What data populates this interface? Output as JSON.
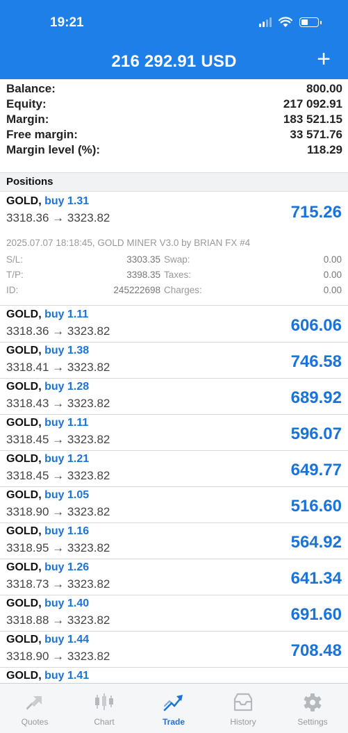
{
  "status_bar": {
    "time": "19:21"
  },
  "header": {
    "title": "216 292.91 USD",
    "add_label": "+"
  },
  "summary": [
    {
      "label": "Balance:",
      "value": "800.00"
    },
    {
      "label": "Equity:",
      "value": "217 092.91"
    },
    {
      "label": "Margin:",
      "value": "183 521.15"
    },
    {
      "label": "Free margin:",
      "value": "33 571.76"
    },
    {
      "label": "Margin level (%):",
      "value": "118.29"
    }
  ],
  "positions_label": "Positions",
  "expanded_position": {
    "symbol": "GOLD,",
    "type": "buy 1.31",
    "prices": "3318.36 → 3323.82",
    "profit": "715.26",
    "comment": "2025.07.07 18:18:45, GOLD MINER V3.0 by BRIAN FX #4",
    "details": {
      "sl_label": "S/L:",
      "sl_value": "3303.35",
      "tp_label": "T/P:",
      "tp_value": "3398.35",
      "id_label": "ID:",
      "id_value": "245222698",
      "swap_label": "Swap:",
      "swap_value": "0.00",
      "taxes_label": "Taxes:",
      "taxes_value": "0.00",
      "charges_label": "Charges:",
      "charges_value": "0.00"
    }
  },
  "positions": [
    {
      "symbol": "GOLD,",
      "type": "buy 1.11",
      "prices": "3318.36 → 3323.82",
      "profit": "606.06"
    },
    {
      "symbol": "GOLD,",
      "type": "buy 1.38",
      "prices": "3318.41 → 3323.82",
      "profit": "746.58"
    },
    {
      "symbol": "GOLD,",
      "type": "buy 1.28",
      "prices": "3318.43 → 3323.82",
      "profit": "689.92"
    },
    {
      "symbol": "GOLD,",
      "type": "buy 1.11",
      "prices": "3318.45 → 3323.82",
      "profit": "596.07"
    },
    {
      "symbol": "GOLD,",
      "type": "buy 1.21",
      "prices": "3318.45 → 3323.82",
      "profit": "649.77"
    },
    {
      "symbol": "GOLD,",
      "type": "buy 1.05",
      "prices": "3318.90 → 3323.82",
      "profit": "516.60"
    },
    {
      "symbol": "GOLD,",
      "type": "buy 1.16",
      "prices": "3318.95 → 3323.82",
      "profit": "564.92"
    },
    {
      "symbol": "GOLD,",
      "type": "buy 1.26",
      "prices": "3318.73 → 3323.82",
      "profit": "641.34"
    },
    {
      "symbol": "GOLD,",
      "type": "buy 1.40",
      "prices": "3318.88 → 3323.82",
      "profit": "691.60"
    },
    {
      "symbol": "GOLD,",
      "type": "buy 1.44",
      "prices": "3318.90 → 3323.82",
      "profit": "708.48"
    },
    {
      "symbol": "GOLD,",
      "type": "buy 1.41",
      "prices": "",
      "profit": ""
    }
  ],
  "tabs": [
    {
      "label": "Quotes",
      "icon": "quotes-icon"
    },
    {
      "label": "Chart",
      "icon": "chart-icon"
    },
    {
      "label": "Trade",
      "icon": "trade-icon",
      "active": true
    },
    {
      "label": "History",
      "icon": "history-icon"
    },
    {
      "label": "Settings",
      "icon": "gear-icon"
    }
  ],
  "colors": {
    "header": "#1f7fe8",
    "profit": "#1a73d9",
    "active_tab": "#1a73d9"
  }
}
